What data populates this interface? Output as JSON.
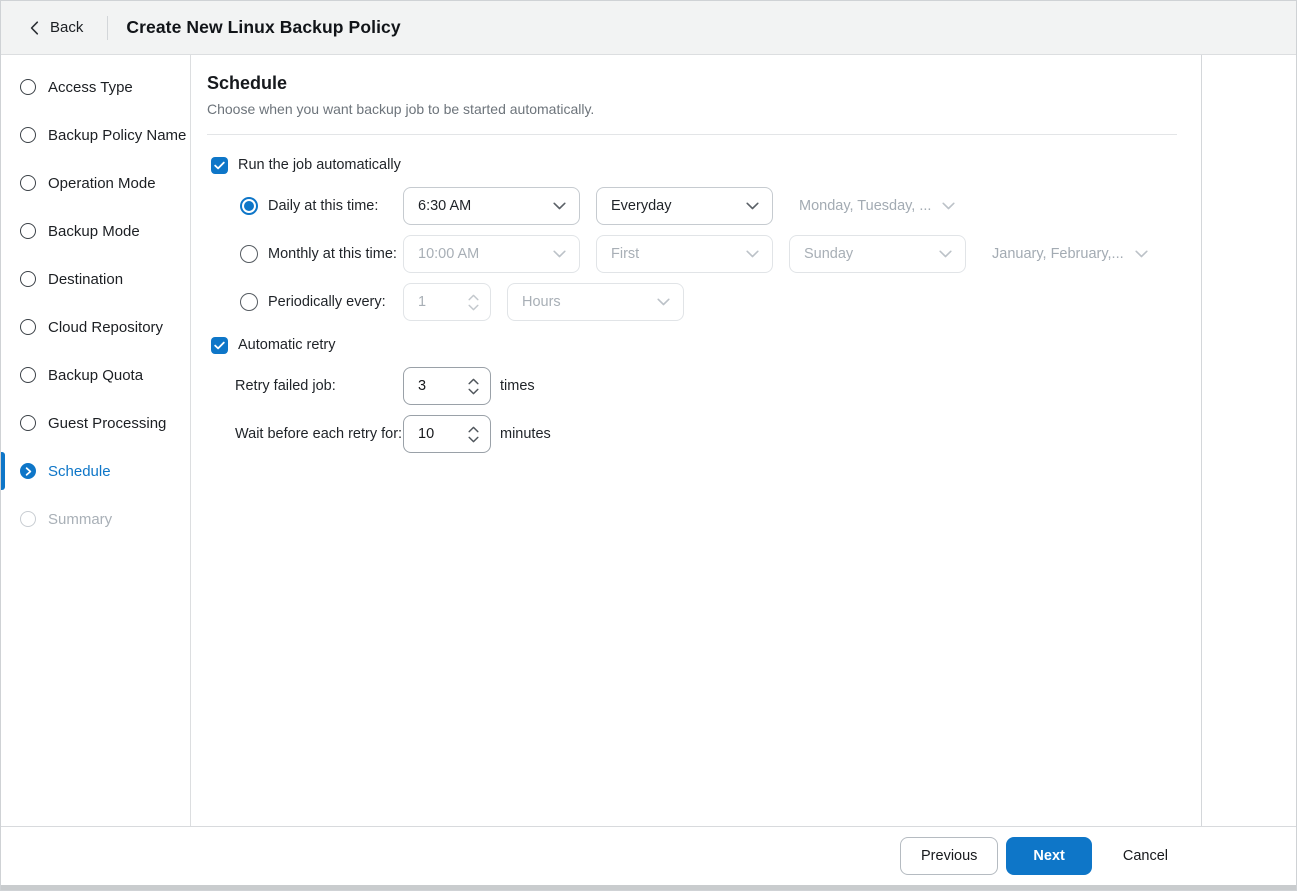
{
  "colors": {
    "accent": "#0e76c8",
    "header_bg": "#f2f3f3",
    "disabled_text": "#a8afb6"
  },
  "icons": {
    "back": "chevron-left-icon",
    "dropdown": "chevron-down-icon",
    "spinner_up": "chevron-up-icon",
    "spinner_down": "chevron-down-icon",
    "active_step": "chevron-right-icon",
    "checkbox": "check-icon"
  },
  "header": {
    "back_label": "Back",
    "title": "Create New Linux Backup Policy"
  },
  "sidebar": {
    "items": [
      {
        "label": "Access Type",
        "state": "default"
      },
      {
        "label": "Backup Policy Name",
        "state": "default"
      },
      {
        "label": "Operation Mode",
        "state": "default"
      },
      {
        "label": "Backup Mode",
        "state": "default"
      },
      {
        "label": "Destination",
        "state": "default"
      },
      {
        "label": "Cloud Repository",
        "state": "default"
      },
      {
        "label": "Backup Quota",
        "state": "default"
      },
      {
        "label": "Guest Processing",
        "state": "default"
      },
      {
        "label": "Schedule",
        "state": "active"
      },
      {
        "label": "Summary",
        "state": "disabled"
      }
    ]
  },
  "main": {
    "section_title": "Schedule",
    "section_subtitle": "Choose when you want backup job to be started automatically.",
    "run_automatically": {
      "label": "Run the job automatically",
      "checked": true
    },
    "daily": {
      "label": "Daily at this time:",
      "selected": true,
      "time": "6:30 AM",
      "frequency": "Everyday",
      "days": "Monday, Tuesday, ..."
    },
    "monthly": {
      "label": "Monthly at this time:",
      "selected": false,
      "time": "10:00 AM",
      "week_number": "First",
      "weekday": "Sunday",
      "months": "January, February,..."
    },
    "periodically": {
      "label": "Periodically every:",
      "selected": false,
      "value": "1",
      "unit": "Hours"
    },
    "automatic_retry": {
      "label": "Automatic retry",
      "checked": true
    },
    "retry_failed": {
      "label": "Retry failed job:",
      "value": "3",
      "suffix": "times"
    },
    "wait_retry": {
      "label": "Wait before each retry for:",
      "value": "10",
      "suffix": "minutes"
    }
  },
  "footer": {
    "previous_label": "Previous",
    "next_label": "Next",
    "cancel_label": "Cancel"
  }
}
